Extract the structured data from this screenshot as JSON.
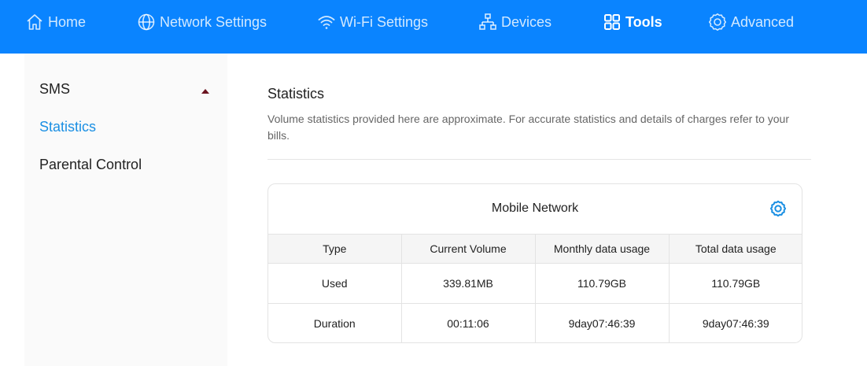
{
  "nav": {
    "home": "Home",
    "network_settings": "Network Settings",
    "wifi_settings": "Wi-Fi Settings",
    "devices": "Devices",
    "tools": "Tools",
    "advanced": "Advanced"
  },
  "sidebar": {
    "items": [
      {
        "label": "SMS"
      },
      {
        "label": "Statistics"
      },
      {
        "label": "Parental Control"
      }
    ]
  },
  "main": {
    "title": "Statistics",
    "description": "Volume statistics provided here are approximate. For accurate statistics and details of charges refer to your bills."
  },
  "card": {
    "title": "Mobile Network",
    "columns": [
      "Type",
      "Current Volume",
      "Monthly data usage",
      "Total data usage"
    ],
    "rows": [
      [
        "Used",
        "339.81MB",
        "110.79GB",
        "110.79GB"
      ],
      [
        "Duration",
        "00:11:06",
        "9day07:46:39",
        "9day07:46:39"
      ]
    ]
  },
  "colors": {
    "nav_bg": "#0a84ff",
    "accent": "#1a8fe3",
    "sidebar_bg": "#fafafa"
  },
  "icons": [
    "home-icon",
    "globe-icon",
    "wifi-icon",
    "devices-icon",
    "tools-icon",
    "gear-icon",
    "caret-up-icon"
  ]
}
